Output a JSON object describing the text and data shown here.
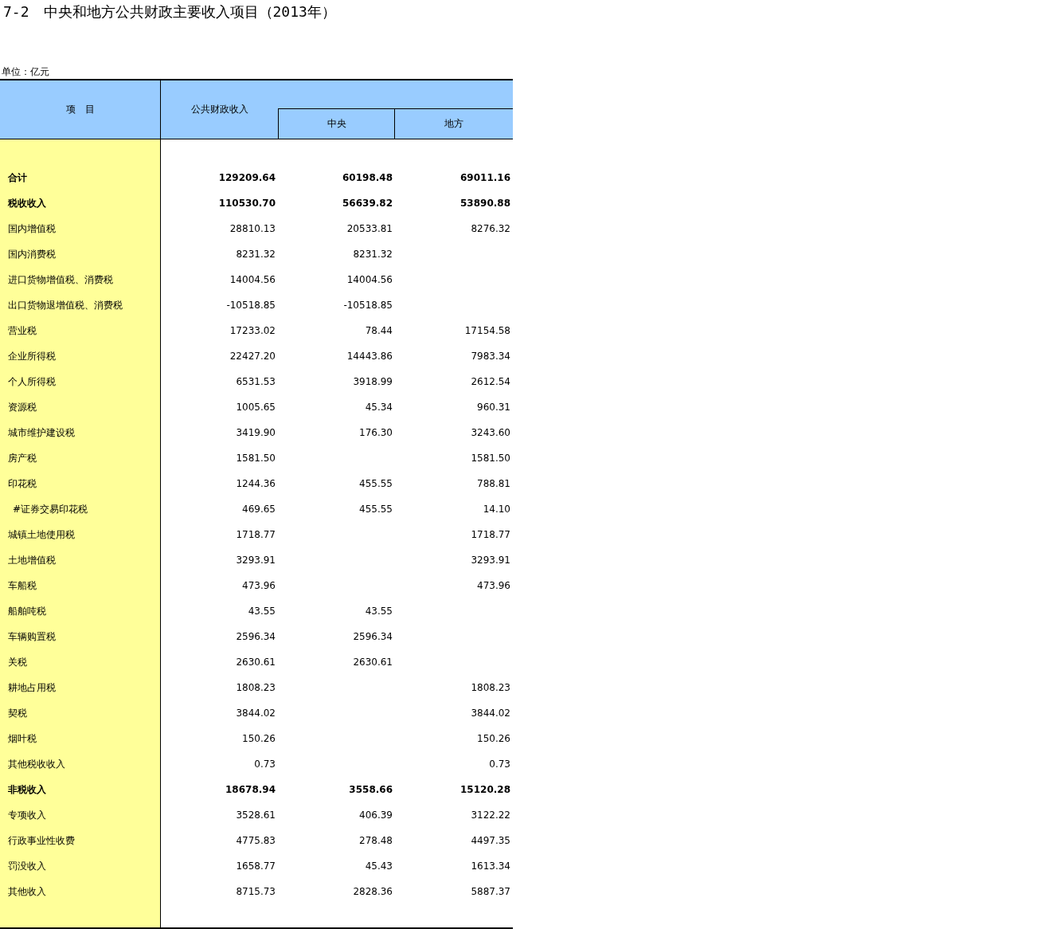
{
  "title": "7-2　中央和地方公共财政主要收入项目（2013年）",
  "unit": "单位：亿元",
  "header": {
    "item": "项　目",
    "total": "公共财政收入",
    "central": "中央",
    "local": "地方"
  },
  "rows": [
    {
      "name": "合计",
      "bold": true,
      "total": "129209.64",
      "central": "60198.48",
      "local": "69011.16"
    },
    {
      "name": "税收收入",
      "bold": true,
      "total": "110530.70",
      "central": "56639.82",
      "local": "53890.88"
    },
    {
      "name": "国内增值税",
      "bold": false,
      "total": "28810.13",
      "central": "20533.81",
      "local": "8276.32"
    },
    {
      "name": "国内消费税",
      "bold": false,
      "total": "8231.32",
      "central": "8231.32"
    },
    {
      "name": "进口货物增值税、消费税",
      "bold": false,
      "total": "14004.56",
      "central": "14004.56"
    },
    {
      "name": "出口货物退增值税、消费税",
      "bold": false,
      "total": "-10518.85",
      "central": "-10518.85"
    },
    {
      "name": "营业税",
      "bold": false,
      "total": "17233.02",
      "central": "78.44",
      "local": "17154.58"
    },
    {
      "name": "企业所得税",
      "bold": false,
      "total": "22427.20",
      "central": "14443.86",
      "local": "7983.34"
    },
    {
      "name": "个人所得税",
      "bold": false,
      "total": "6531.53",
      "central": "3918.99",
      "local": "2612.54"
    },
    {
      "name": "资源税",
      "bold": false,
      "total": "1005.65",
      "central": "45.34",
      "local": "960.31"
    },
    {
      "name": "城市维护建设税",
      "bold": false,
      "total": "3419.90",
      "central": "176.30",
      "local": "3243.60"
    },
    {
      "name": "房产税",
      "bold": false,
      "total": "1581.50",
      "local": "1581.50"
    },
    {
      "name": "印花税",
      "bold": false,
      "total": "1244.36",
      "central": "455.55",
      "local": "788.81",
      "children": [
        {
          "name": "#证券交易印花税",
          "bold": false,
          "total": "469.65",
          "central": "455.55",
          "local": "14.10"
        }
      ]
    },
    {
      "name": "城镇土地使用税",
      "bold": false,
      "total": "1718.77",
      "local": "1718.77"
    },
    {
      "name": "土地增值税",
      "bold": false,
      "total": "3293.91",
      "local": "3293.91"
    },
    {
      "name": "车船税",
      "bold": false,
      "total": "473.96",
      "local": "473.96"
    },
    {
      "name": "船舶吨税",
      "bold": false,
      "total": "43.55",
      "central": "43.55"
    },
    {
      "name": "车辆购置税",
      "bold": false,
      "total": "2596.34",
      "central": "2596.34"
    },
    {
      "name": "关税",
      "bold": false,
      "total": "2630.61",
      "central": "2630.61"
    },
    {
      "name": "耕地占用税",
      "bold": false,
      "total": "1808.23",
      "local": "1808.23"
    },
    {
      "name": "契税",
      "bold": false,
      "total": "3844.02",
      "local": "3844.02"
    },
    {
      "name": "烟叶税",
      "bold": false,
      "total": "150.26",
      "local": "150.26"
    },
    {
      "name": "其他税收收入",
      "bold": false,
      "total": "0.73",
      "local": "0.73"
    },
    {
      "name": "非税收入",
      "bold": true,
      "total": "18678.94",
      "central": "3558.66",
      "local": "15120.28"
    },
    {
      "name": "专项收入",
      "bold": false,
      "total": "3528.61",
      "central": "406.39",
      "local": "3122.22"
    },
    {
      "name": "行政事业性收费",
      "bold": false,
      "total": "4775.83",
      "central": "278.48",
      "local": "4497.35"
    },
    {
      "name": "罚没收入",
      "bold": false,
      "total": "1658.77",
      "central": "45.43",
      "local": "1613.34"
    },
    {
      "name": "其他收入",
      "bold": false,
      "total": "8715.73",
      "central": "2828.36",
      "local": "5887.37"
    }
  ]
}
